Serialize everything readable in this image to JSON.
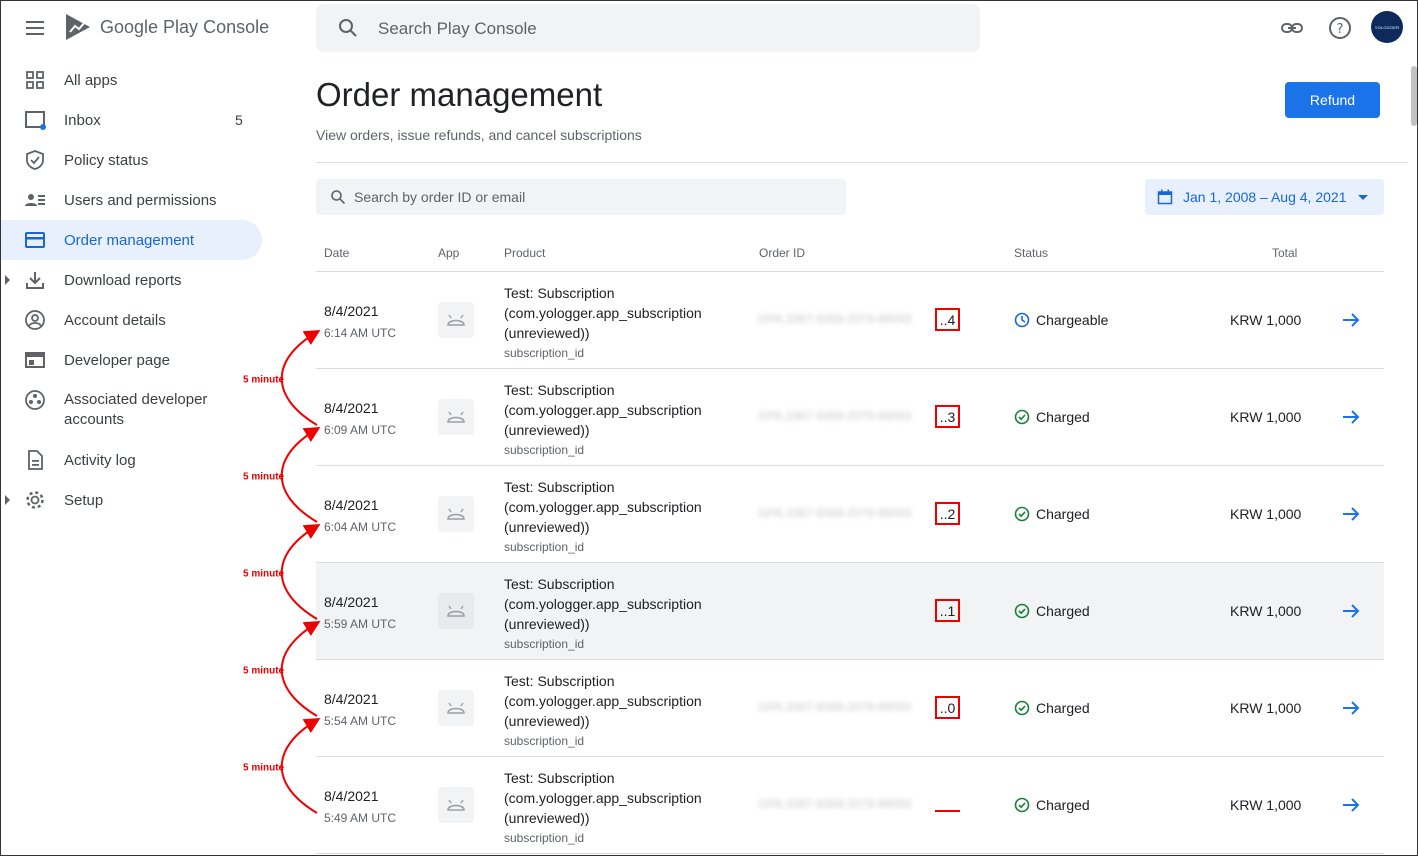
{
  "app": {
    "brand_google": "Google Play",
    "brand_console": "Console"
  },
  "header": {
    "search_placeholder": "Search Play Console",
    "avatar_text": "YOLOGGER",
    "icons": [
      "link-icon",
      "help-icon"
    ]
  },
  "sidebar": {
    "items": [
      {
        "label": "All apps",
        "icon": "grid-icon"
      },
      {
        "label": "Inbox",
        "icon": "inbox-icon",
        "badge": "5"
      },
      {
        "label": "Policy status",
        "icon": "shield-icon"
      },
      {
        "label": "Users and permissions",
        "icon": "users-icon"
      },
      {
        "label": "Order management",
        "icon": "card-icon",
        "active": true
      },
      {
        "label": "Download reports",
        "icon": "download-icon",
        "expandable": true
      },
      {
        "label": "Account details",
        "icon": "account-icon"
      },
      {
        "label": "Developer page",
        "icon": "web-icon"
      },
      {
        "label_line1": "Associated developer",
        "label_line2": "accounts",
        "icon": "associated-icon"
      },
      {
        "label": "Activity log",
        "icon": "document-icon"
      },
      {
        "label": "Setup",
        "icon": "gear-icon",
        "expandable": true
      }
    ]
  },
  "main": {
    "title": "Order management",
    "subtitle": "View orders, issue refunds, and cancel subscriptions",
    "refund_label": "Refund",
    "order_search_placeholder": "Search by order ID or email",
    "date_range": "Jan 1, 2008 – Aug 4, 2021"
  },
  "table": {
    "columns": {
      "date": "Date",
      "app": "App",
      "product": "Product",
      "order_id": "Order ID",
      "status": "Status",
      "total": "Total"
    },
    "rows": [
      {
        "date": "8/4/2021",
        "time": "6:14 AM UTC",
        "product": [
          "Test: Subscription",
          "(com.yologger.app_subscription",
          "(unreviewed))"
        ],
        "sku": "subscription_id",
        "order_blur": "GPA.3367-9369-2079-99093",
        "order_suffix": "..4",
        "status": "Chargeable",
        "total": "KRW 1,000"
      },
      {
        "date": "8/4/2021",
        "time": "6:09 AM UTC",
        "product": [
          "Test: Subscription",
          "(com.yologger.app_subscription",
          "(unreviewed))"
        ],
        "sku": "subscription_id",
        "order_blur": "GPA.3367-9369-2079-99093",
        "order_suffix": "..3",
        "status": "Charged",
        "total": "KRW 1,000"
      },
      {
        "date": "8/4/2021",
        "time": "6:04 AM UTC",
        "product": [
          "Test: Subscription",
          "(com.yologger.app_subscription",
          "(unreviewed))"
        ],
        "sku": "subscription_id",
        "order_blur": "GPA.3367-9369-2079-99093",
        "order_suffix": "..2",
        "status": "Charged",
        "total": "KRW 1,000"
      },
      {
        "date": "8/4/2021",
        "time": "5:59 AM UTC",
        "product": [
          "Test: Subscription",
          "(com.yologger.app_subscription",
          "(unreviewed))"
        ],
        "sku": "subscription_id",
        "order_blur": "",
        "order_suffix": "..1",
        "status": "Charged",
        "total": "KRW 1,000"
      },
      {
        "date": "8/4/2021",
        "time": "5:54 AM UTC",
        "product": [
          "Test: Subscription",
          "(com.yologger.app_subscription",
          "(unreviewed))"
        ],
        "sku": "subscription_id",
        "order_blur": "GPA.3367-9369-2079-99093",
        "order_suffix": "..0",
        "status": "Charged",
        "total": "KRW 1,000"
      },
      {
        "date": "8/4/2021",
        "time": "5:49 AM UTC",
        "product": [
          "Test: Subscription",
          "(com.yologger.app_subscription",
          "(unreviewed))"
        ],
        "sku": "subscription_id",
        "order_blur": "GPA.3367-9369-2079-99093",
        "order_suffix": "",
        "status": "Charged",
        "total": "KRW 1,000"
      }
    ]
  },
  "annotations": {
    "interval_label": "5 minute",
    "color": "#ee0000"
  },
  "colors": {
    "accent": "#1a73e8",
    "active_bg": "#e8f0fe",
    "charged_green": "#188038"
  }
}
